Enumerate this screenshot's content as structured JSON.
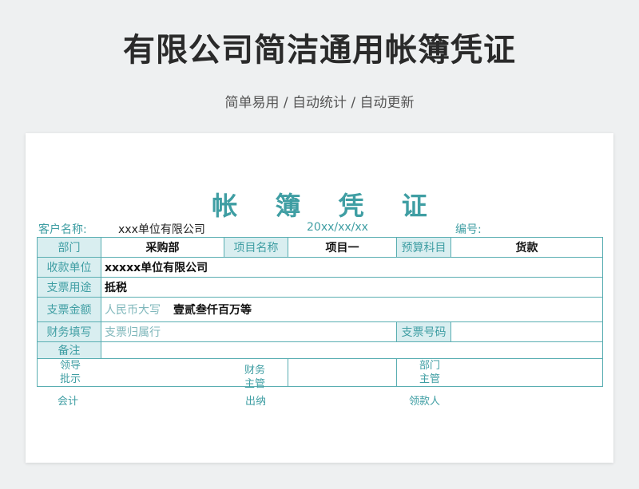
{
  "page": {
    "title": "有限公司简洁通用帐簿凭证",
    "subtitle": "简单易用 / 自动统计 / 自动更新"
  },
  "voucher": {
    "title": "帐 簿 凭 证",
    "client_label": "客户名称:",
    "client_value": "xxx单位有限公司",
    "date": "20xx/xx/xx",
    "number_label": "编号:",
    "rows": {
      "dept_label": "部门",
      "dept_value": "采购部",
      "project_label": "项目名称",
      "project_value": "项目一",
      "budget_label": "预算科目",
      "budget_value": "货款",
      "payee_label": "收款单位",
      "payee_value": "xxxxx单位有限公司",
      "purpose_label": "支票用途",
      "purpose_value": "抵税",
      "amount_label": "支票金额",
      "amount_sub_label": "人民币大写",
      "amount_value": "壹贰叁仟百万等",
      "finance_label": "财务填写",
      "finance_value": "支票归属行",
      "check_no_label": "支票号码",
      "check_no_value": "",
      "remark_label": "备注",
      "remark_value": ""
    },
    "signatures": {
      "leader_1": "领导",
      "leader_2": "批示",
      "finance_1": "财务",
      "finance_2": "主管",
      "dept_1": "部门",
      "dept_2": "主管"
    },
    "footer": {
      "accountant": "会计",
      "cashier": "出纳",
      "receiver": "领款人"
    }
  }
}
